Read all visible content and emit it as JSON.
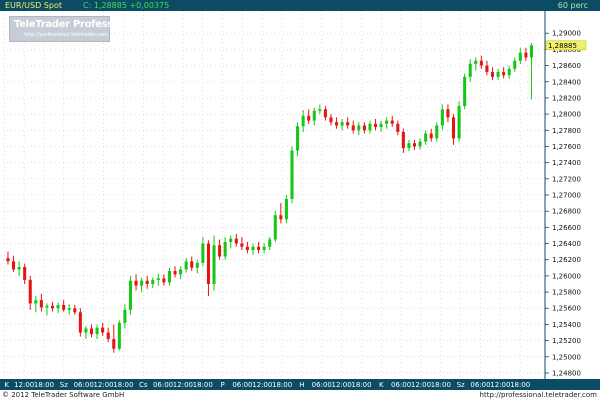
{
  "header": {
    "symbol": "EUR/USD Spot",
    "change": "C: 1,28885 +0,00375",
    "interval": "60 perc"
  },
  "logo": {
    "title": "TeleTrader Professional",
    "url": "http://professional.teletrader.com"
  },
  "footer": {
    "copyright": "© 2012 TeleTrader Software GmbH",
    "url": "http://professional.teletrader.com"
  },
  "colors": {
    "up_candle": "#17c717",
    "down_candle": "#e81414",
    "price_marker": "#f2f26a",
    "grid": "#c8c8c8",
    "header_bg": "#0b4b63",
    "axis_bg": "#0b4b63"
  },
  "chart_data": {
    "type": "candlestick",
    "symbol": "EUR/USD",
    "interval": "60 perc",
    "ylim": [
      1.2475,
      1.2925
    ],
    "y_ticks": [
      1.248,
      1.25,
      1.252,
      1.254,
      1.256,
      1.258,
      1.26,
      1.262,
      1.264,
      1.266,
      1.268,
      1.27,
      1.272,
      1.274,
      1.276,
      1.278,
      1.28,
      1.282,
      1.284,
      1.286,
      1.288,
      1.29
    ],
    "y_tick_labels": [
      "1,24800",
      "1,25000",
      "1,25200",
      "1,25400",
      "1,25600",
      "1,25800",
      "1,26000",
      "1,26200",
      "1,26400",
      "1,26600",
      "1,26800",
      "1,27000",
      "1,27200",
      "1,27400",
      "1,27600",
      "1,27800",
      "1,28000",
      "1,28200",
      "1,28400",
      "1,28600",
      "1,28800",
      "1,29000"
    ],
    "last_price_label": "1,28885",
    "x_tick_labels": [
      "K",
      "12:00",
      "18:00",
      "Sz",
      "06:00",
      "12:00",
      "18:00",
      "Cs",
      "06:00",
      "12:00",
      "18:00",
      "P",
      "06:00",
      "12:00",
      "18:00",
      "H",
      "06:00",
      "12:00",
      "18:00",
      "K",
      "06:00",
      "12:00",
      "18:00",
      "Sz",
      "06:00",
      "12:00",
      "18:00"
    ],
    "x_tick_slots": [
      0.1,
      6.1,
      12.1,
      18.1,
      24.1,
      30.1,
      36.1,
      42.1,
      48.1,
      54.1,
      60.1,
      66.1,
      72.1,
      78.1,
      84.1,
      90.1,
      96.1,
      102.1,
      108.1,
      114.1,
      120.1,
      126.1,
      132.1,
      138.1,
      144.1,
      150.1,
      156.1
    ],
    "slot_count": 163,
    "grid": true,
    "candles": [
      {
        "o": 1.2622,
        "h": 1.263,
        "l": 1.2614,
        "c": 1.2618
      },
      {
        "o": 1.2618,
        "h": 1.2625,
        "l": 1.2605,
        "c": 1.2608
      },
      {
        "o": 1.2608,
        "h": 1.2618,
        "l": 1.26,
        "c": 1.2611
      },
      {
        "o": 1.2611,
        "h": 1.2615,
        "l": 1.259,
        "c": 1.2595
      },
      {
        "o": 1.2595,
        "h": 1.26,
        "l": 1.2558,
        "c": 1.2566
      },
      {
        "o": 1.2566,
        "h": 1.2575,
        "l": 1.2555,
        "c": 1.257
      },
      {
        "o": 1.257,
        "h": 1.2578,
        "l": 1.2556,
        "c": 1.2561
      },
      {
        "o": 1.2561,
        "h": 1.2566,
        "l": 1.2551,
        "c": 1.2563
      },
      {
        "o": 1.2563,
        "h": 1.2568,
        "l": 1.2556,
        "c": 1.256
      },
      {
        "o": 1.256,
        "h": 1.2567,
        "l": 1.2554,
        "c": 1.2564
      },
      {
        "o": 1.2564,
        "h": 1.257,
        "l": 1.2556,
        "c": 1.2558
      },
      {
        "o": 1.2558,
        "h": 1.2565,
        "l": 1.2552,
        "c": 1.256
      },
      {
        "o": 1.256,
        "h": 1.2564,
        "l": 1.2552,
        "c": 1.2555
      },
      {
        "o": 1.2555,
        "h": 1.256,
        "l": 1.2525,
        "c": 1.253
      },
      {
        "o": 1.253,
        "h": 1.2538,
        "l": 1.2522,
        "c": 1.2535
      },
      {
        "o": 1.2535,
        "h": 1.254,
        "l": 1.2524,
        "c": 1.2528
      },
      {
        "o": 1.2528,
        "h": 1.254,
        "l": 1.2522,
        "c": 1.2536
      },
      {
        "o": 1.2536,
        "h": 1.2542,
        "l": 1.2526,
        "c": 1.253
      },
      {
        "o": 1.253,
        "h": 1.2536,
        "l": 1.2518,
        "c": 1.2522
      },
      {
        "o": 1.2522,
        "h": 1.254,
        "l": 1.2505,
        "c": 1.251
      },
      {
        "o": 1.251,
        "h": 1.2545,
        "l": 1.2508,
        "c": 1.2542
      },
      {
        "o": 1.2542,
        "h": 1.2565,
        "l": 1.2535,
        "c": 1.2558
      },
      {
        "o": 1.2558,
        "h": 1.26,
        "l": 1.2552,
        "c": 1.2594
      },
      {
        "o": 1.2594,
        "h": 1.2602,
        "l": 1.2582,
        "c": 1.2588
      },
      {
        "o": 1.2588,
        "h": 1.2598,
        "l": 1.258,
        "c": 1.2594
      },
      {
        "o": 1.2594,
        "h": 1.26,
        "l": 1.2584,
        "c": 1.259
      },
      {
        "o": 1.259,
        "h": 1.2598,
        "l": 1.2585,
        "c": 1.2595
      },
      {
        "o": 1.2595,
        "h": 1.2603,
        "l": 1.2588,
        "c": 1.2597
      },
      {
        "o": 1.2597,
        "h": 1.2602,
        "l": 1.2588,
        "c": 1.2592
      },
      {
        "o": 1.2592,
        "h": 1.261,
        "l": 1.2588,
        "c": 1.2606
      },
      {
        "o": 1.2606,
        "h": 1.2612,
        "l": 1.2598,
        "c": 1.2602
      },
      {
        "o": 1.2602,
        "h": 1.2612,
        "l": 1.2596,
        "c": 1.2608
      },
      {
        "o": 1.2608,
        "h": 1.2622,
        "l": 1.2604,
        "c": 1.2618
      },
      {
        "o": 1.2618,
        "h": 1.2624,
        "l": 1.2606,
        "c": 1.261
      },
      {
        "o": 1.261,
        "h": 1.262,
        "l": 1.2603,
        "c": 1.2616
      },
      {
        "o": 1.2616,
        "h": 1.2648,
        "l": 1.2612,
        "c": 1.264
      },
      {
        "o": 1.264,
        "h": 1.2644,
        "l": 1.2575,
        "c": 1.259
      },
      {
        "o": 1.259,
        "h": 1.265,
        "l": 1.2582,
        "c": 1.2638
      },
      {
        "o": 1.2638,
        "h": 1.2645,
        "l": 1.262,
        "c": 1.2624
      },
      {
        "o": 1.2624,
        "h": 1.2648,
        "l": 1.262,
        "c": 1.2642
      },
      {
        "o": 1.2642,
        "h": 1.265,
        "l": 1.2634,
        "c": 1.2646
      },
      {
        "o": 1.2646,
        "h": 1.2652,
        "l": 1.2636,
        "c": 1.264
      },
      {
        "o": 1.264,
        "h": 1.2648,
        "l": 1.2632,
        "c": 1.2636
      },
      {
        "o": 1.2636,
        "h": 1.2642,
        "l": 1.2628,
        "c": 1.2632
      },
      {
        "o": 1.2632,
        "h": 1.264,
        "l": 1.2626,
        "c": 1.2636
      },
      {
        "o": 1.2636,
        "h": 1.2642,
        "l": 1.2628,
        "c": 1.2632
      },
      {
        "o": 1.2632,
        "h": 1.264,
        "l": 1.2628,
        "c": 1.2636
      },
      {
        "o": 1.2636,
        "h": 1.2648,
        "l": 1.2632,
        "c": 1.2645
      },
      {
        "o": 1.2645,
        "h": 1.268,
        "l": 1.2642,
        "c": 1.2675
      },
      {
        "o": 1.2675,
        "h": 1.269,
        "l": 1.2665,
        "c": 1.267
      },
      {
        "o": 1.267,
        "h": 1.27,
        "l": 1.2665,
        "c": 1.2695
      },
      {
        "o": 1.2695,
        "h": 1.276,
        "l": 1.269,
        "c": 1.2755
      },
      {
        "o": 1.2755,
        "h": 1.279,
        "l": 1.2748,
        "c": 1.2785
      },
      {
        "o": 1.2785,
        "h": 1.2805,
        "l": 1.2778,
        "c": 1.2798
      },
      {
        "o": 1.2798,
        "h": 1.2806,
        "l": 1.2788,
        "c": 1.2792
      },
      {
        "o": 1.2792,
        "h": 1.2808,
        "l": 1.2786,
        "c": 1.2804
      },
      {
        "o": 1.2804,
        "h": 1.2812,
        "l": 1.28,
        "c": 1.2806
      },
      {
        "o": 1.2806,
        "h": 1.281,
        "l": 1.2792,
        "c": 1.2796
      },
      {
        "o": 1.2796,
        "h": 1.28,
        "l": 1.2786,
        "c": 1.279
      },
      {
        "o": 1.279,
        "h": 1.2796,
        "l": 1.2782,
        "c": 1.2786
      },
      {
        "o": 1.2786,
        "h": 1.2794,
        "l": 1.278,
        "c": 1.279
      },
      {
        "o": 1.279,
        "h": 1.2796,
        "l": 1.2782,
        "c": 1.2786
      },
      {
        "o": 1.2786,
        "h": 1.2792,
        "l": 1.2776,
        "c": 1.278
      },
      {
        "o": 1.278,
        "h": 1.279,
        "l": 1.2774,
        "c": 1.2786
      },
      {
        "o": 1.2786,
        "h": 1.279,
        "l": 1.2776,
        "c": 1.278
      },
      {
        "o": 1.278,
        "h": 1.2792,
        "l": 1.2776,
        "c": 1.2788
      },
      {
        "o": 1.2788,
        "h": 1.2794,
        "l": 1.278,
        "c": 1.2784
      },
      {
        "o": 1.2784,
        "h": 1.2792,
        "l": 1.2778,
        "c": 1.2788
      },
      {
        "o": 1.2788,
        "h": 1.2796,
        "l": 1.2782,
        "c": 1.2792
      },
      {
        "o": 1.2792,
        "h": 1.2798,
        "l": 1.2784,
        "c": 1.2788
      },
      {
        "o": 1.2788,
        "h": 1.2792,
        "l": 1.2774,
        "c": 1.2778
      },
      {
        "o": 1.2778,
        "h": 1.2782,
        "l": 1.2752,
        "c": 1.2758
      },
      {
        "o": 1.2758,
        "h": 1.2768,
        "l": 1.2754,
        "c": 1.2764
      },
      {
        "o": 1.2764,
        "h": 1.2768,
        "l": 1.2756,
        "c": 1.276
      },
      {
        "o": 1.276,
        "h": 1.277,
        "l": 1.2756,
        "c": 1.2766
      },
      {
        "o": 1.2766,
        "h": 1.278,
        "l": 1.2762,
        "c": 1.2776
      },
      {
        "o": 1.2776,
        "h": 1.2782,
        "l": 1.2766,
        "c": 1.277
      },
      {
        "o": 1.277,
        "h": 1.279,
        "l": 1.2766,
        "c": 1.2786
      },
      {
        "o": 1.2786,
        "h": 1.2812,
        "l": 1.278,
        "c": 1.2806
      },
      {
        "o": 1.2806,
        "h": 1.2812,
        "l": 1.279,
        "c": 1.2796
      },
      {
        "o": 1.2796,
        "h": 1.28,
        "l": 1.2762,
        "c": 1.277
      },
      {
        "o": 1.277,
        "h": 1.2816,
        "l": 1.2766,
        "c": 1.281
      },
      {
        "o": 1.281,
        "h": 1.285,
        "l": 1.2806,
        "c": 1.2846
      },
      {
        "o": 1.2846,
        "h": 1.2868,
        "l": 1.284,
        "c": 1.2862
      },
      {
        "o": 1.2862,
        "h": 1.287,
        "l": 1.2854,
        "c": 1.2866
      },
      {
        "o": 1.2866,
        "h": 1.2872,
        "l": 1.2856,
        "c": 1.286
      },
      {
        "o": 1.286,
        "h": 1.2866,
        "l": 1.2848,
        "c": 1.2852
      },
      {
        "o": 1.2852,
        "h": 1.2858,
        "l": 1.2842,
        "c": 1.2846
      },
      {
        "o": 1.2846,
        "h": 1.2856,
        "l": 1.2842,
        "c": 1.2852
      },
      {
        "o": 1.2852,
        "h": 1.2858,
        "l": 1.2844,
        "c": 1.2848
      },
      {
        "o": 1.2848,
        "h": 1.286,
        "l": 1.2844,
        "c": 1.2856
      },
      {
        "o": 1.2856,
        "h": 1.287,
        "l": 1.2852,
        "c": 1.2866
      },
      {
        "o": 1.2866,
        "h": 1.2882,
        "l": 1.2862,
        "c": 1.2876
      },
      {
        "o": 1.2876,
        "h": 1.2882,
        "l": 1.2866,
        "c": 1.287
      },
      {
        "o": 1.287,
        "h": 1.2888,
        "l": 1.2818,
        "c": 1.2885
      }
    ]
  }
}
